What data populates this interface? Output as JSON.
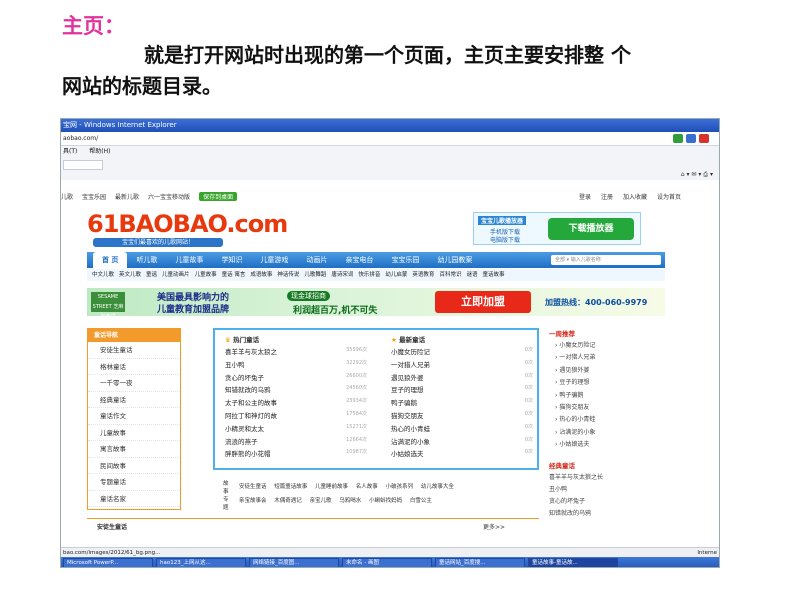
{
  "slide": {
    "title": "主页：",
    "body_line1": "就是打开网站时出现的第一个页面，主页主要安排整  个",
    "body_line2": "网站的标题目录。"
  },
  "browser": {
    "title_bar": "宝网 - Windows Internet Explorer",
    "address": "aobao.com/",
    "menu": [
      "具(T)",
      "帮助(H)"
    ],
    "status_url": "bao.com/images/2012/61_bg.png...",
    "status_zone": "Interne"
  },
  "site": {
    "top_links": [
      "儿歌",
      "宝宝乐园",
      "最新儿歌",
      "六一宝宝移动版"
    ],
    "top_green": "保存到桌面",
    "top_right": [
      "登录",
      "注册",
      "加入收藏",
      "设为首页"
    ],
    "logo_text": "61BAOBAO.com",
    "logo_tagline": "宝宝们最喜欢的儿歌网站！",
    "promo": {
      "title": "宝宝儿歌播放器",
      "phone_dl": "手机版下载",
      "pc_dl": "电脑版下载",
      "button": "下载播放器"
    },
    "main_nav": [
      "首 页",
      "听儿歌",
      "儿童故事",
      "学知识",
      "儿童游戏",
      "动画片",
      "亲宝电台",
      "宝宝乐园",
      "幼儿园教案"
    ],
    "search_placeholder": "全部 ▾ 输入儿歌名称",
    "sub_nav": [
      "中文儿歌",
      "英文儿歌",
      "童谣",
      "儿童动画片",
      "儿童故事",
      "童话 寓言",
      "成语故事",
      "神话传说",
      "儿歌舞蹈",
      "唐诗宋词",
      "快乐拼音",
      "幼儿启蒙",
      "英语教育",
      "百科常识",
      "谜语",
      "童话故事"
    ],
    "banner": {
      "left_logo": "SESAME STREET 芝麻街英语",
      "line1": "美国最具影响力的",
      "line2": "儿童教育加盟品牌",
      "badge": "现金球招商",
      "line3": "利润超百万,机不可失",
      "join": "立即加盟",
      "phone": "加盟热线：400-060-9979"
    },
    "left_panel": {
      "title": "童话导航",
      "items": [
        "安徒生童话",
        "格林童话",
        "一千零一夜",
        "经典童话",
        "童话作文",
        "儿童故事",
        "寓言故事",
        "民间故事",
        "专题童话",
        "童话名家"
      ]
    },
    "hot": {
      "title": "热门童话",
      "items": [
        {
          "name": "喜羊羊与灰太狼之",
          "count": "35596次"
        },
        {
          "name": "丑小鸭",
          "count": "32292次"
        },
        {
          "name": "贪心的坏兔子",
          "count": "26600次"
        },
        {
          "name": "知错就改的乌鸦",
          "count": "24560次"
        },
        {
          "name": "太子和公主的故事",
          "count": "23934次"
        },
        {
          "name": "阿拉丁和神灯的故",
          "count": "17584次"
        },
        {
          "name": "小精灵和太太",
          "count": "15271次"
        },
        {
          "name": "流浪的燕子",
          "count": "12664次"
        },
        {
          "name": "胖胖熊的小花帽",
          "count": "10987次"
        }
      ]
    },
    "latest": {
      "title": "最新童话",
      "items": [
        {
          "name": "小魔女历险记",
          "count": "0次"
        },
        {
          "name": "一对猎人兄弟",
          "count": "0次"
        },
        {
          "name": "遇见狼外婆",
          "count": "0次"
        },
        {
          "name": "豆子的理想",
          "count": "0次"
        },
        {
          "name": "鸭子骗鹅",
          "count": "0次"
        },
        {
          "name": "猫狗交朋友",
          "count": "0次"
        },
        {
          "name": "热心的小青蛙",
          "count": "0次"
        },
        {
          "name": "沾满泥的小象",
          "count": "0次"
        },
        {
          "name": "小姑娘选夫",
          "count": "0次"
        }
      ]
    },
    "tags": {
      "label": "故事专题",
      "row1": [
        "安徒生童话",
        "短篇童话故事",
        "儿童睡前故事",
        "名人故事",
        "小破孩系列",
        "幼儿故事大全"
      ],
      "row2": [
        "亲宝故事会",
        "木偶奇遇记",
        "亲宝儿歌",
        "乌鸦喝水",
        "小蝌蚪找妈妈",
        "白雪公主"
      ]
    },
    "right_panel": {
      "title": "一周推荐",
      "items": [
        "小魔女历险记",
        "一对猎人兄弟",
        "遇见狼外婆",
        "豆子的理想",
        "鸭子骗鹅",
        "猫狗交朋友",
        "热心的小青蛙",
        "沾满泥的小象",
        "小姑娘选夫"
      ],
      "title2": "经典童话",
      "items2": [
        "喜羊羊与灰太狼之长",
        "丑小鸭",
        "贪心的坏兔子",
        "知错就改的乌鸦"
      ]
    },
    "bottom": {
      "title": "安徒生童话",
      "more": "更多>>"
    }
  },
  "taskbar": [
    "Microsoft PowerP...",
    "hao123_上网从这...",
    "网络链接_百度图...",
    "未命名 - 画图",
    "童话网站_百度搜...",
    "童话故事-童话故..."
  ]
}
